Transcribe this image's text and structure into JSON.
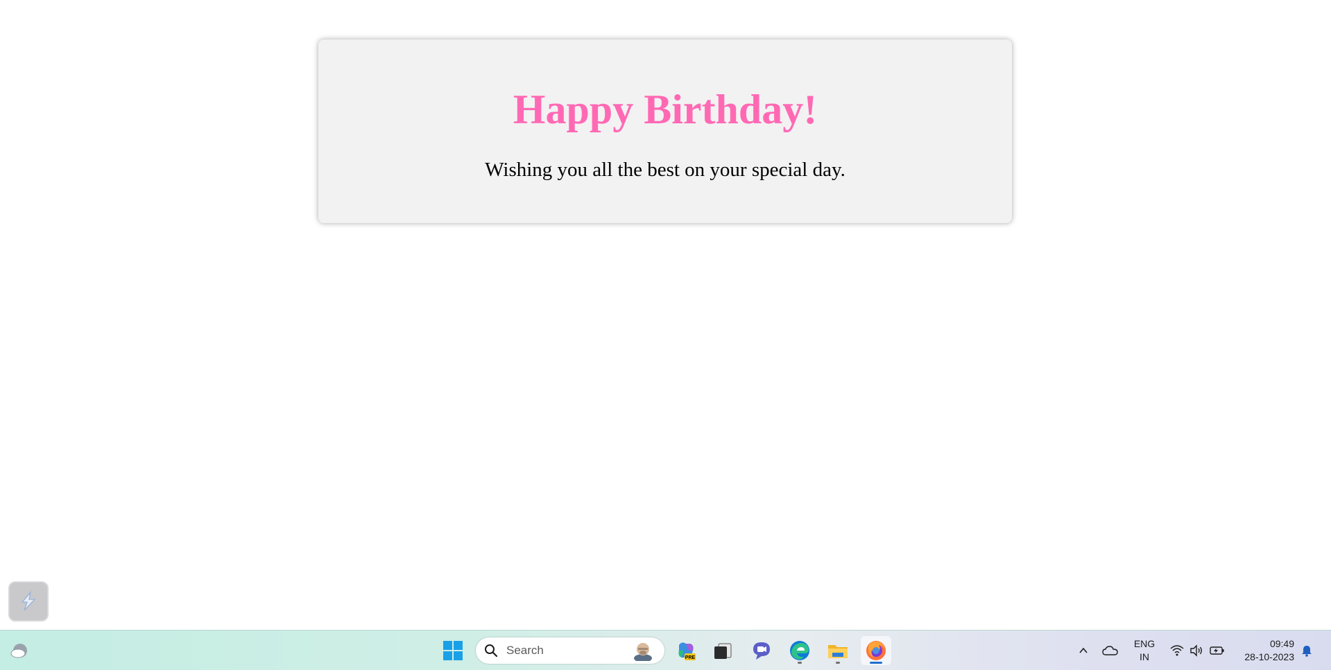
{
  "card": {
    "heading": "Happy Birthday!",
    "message": "Wishing you all the best on your special day.",
    "heading_color": "#ff69b4",
    "background_color": "#f2f2f2"
  },
  "taskbar": {
    "search_placeholder": "Search",
    "language_line1": "ENG",
    "language_line2": "IN",
    "time": "09:49",
    "date": "28-10-2023",
    "copilot_badge": "PRE",
    "pinned_apps": [
      {
        "name": "start-icon"
      },
      {
        "name": "copilot-icon"
      },
      {
        "name": "task-view-icon"
      },
      {
        "name": "chat-icon"
      },
      {
        "name": "edge-icon"
      },
      {
        "name": "file-explorer-icon"
      },
      {
        "name": "firefox-icon"
      }
    ],
    "tray_icons": [
      "chevron-up-icon",
      "onedrive-icon",
      "wifi-icon",
      "volume-icon",
      "battery-icon",
      "notification-bell-icon"
    ]
  }
}
